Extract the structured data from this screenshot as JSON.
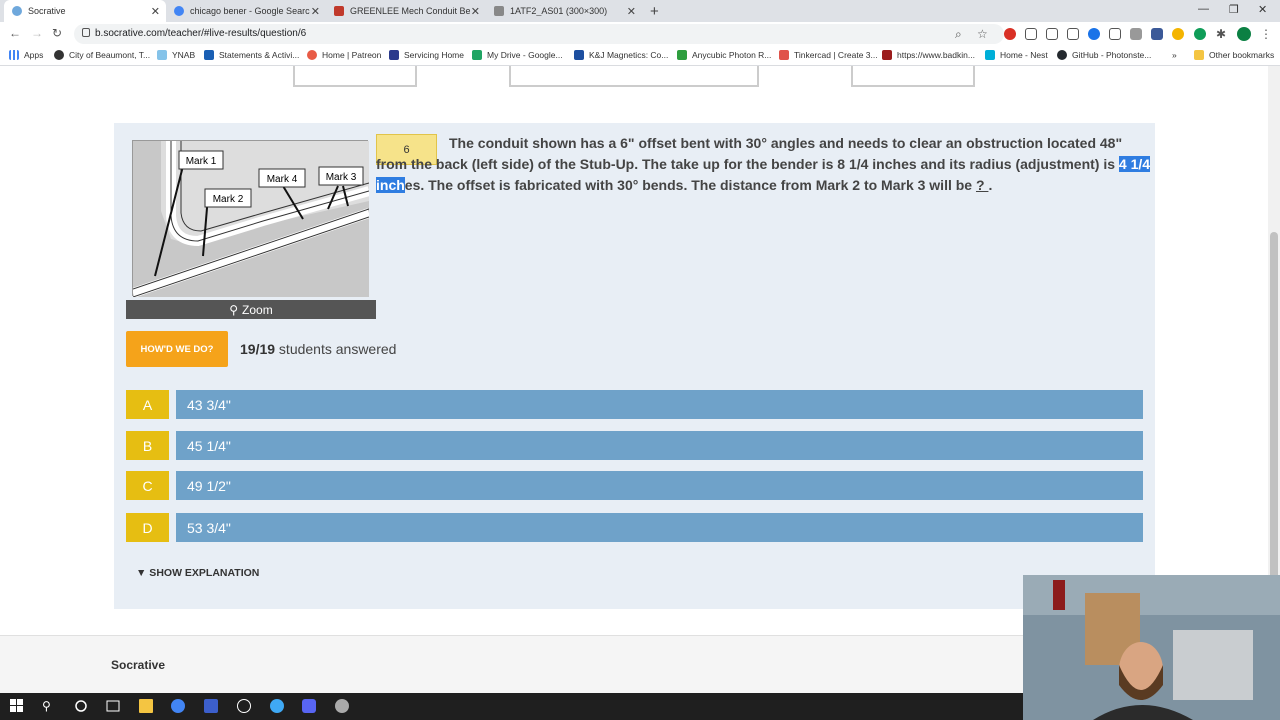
{
  "browser": {
    "tabs": [
      {
        "title": "Socrative",
        "active": true
      },
      {
        "title": "chicago bener - Google Search",
        "active": false
      },
      {
        "title": "GREENLEE Mech Conduit Bender",
        "active": false
      },
      {
        "title": "1ATF2_AS01 (300×300)",
        "active": false
      }
    ],
    "new_tab": "+",
    "close_glyph": "✕",
    "window_controls": {
      "minimize": "—",
      "maximize": "❐",
      "close": "✕"
    },
    "url": "b.socrative.com/teacher/#live-results/question/6",
    "bookmarks": [
      {
        "label": "Apps",
        "color": "#4285f4"
      },
      {
        "label": "City of Beaumont, T...",
        "color": "#333333"
      },
      {
        "label": "YNAB",
        "color": "#85c3e9"
      },
      {
        "label": "Statements & Activi...",
        "color": "#1a5fb4"
      },
      {
        "label": "Home | Patreon",
        "color": "#e85b46"
      },
      {
        "label": "Servicing Home",
        "color": "#2b3a8c"
      },
      {
        "label": "My Drive - Google...",
        "color": "#1fa463"
      },
      {
        "label": "K&J Magnetics: Co...",
        "color": "#1d4fa0"
      },
      {
        "label": "Anycubic Photon R...",
        "color": "#2e9e3e"
      },
      {
        "label": "Tinkercad | Create 3...",
        "color": "#e0534a"
      },
      {
        "label": "https://www.badkin...",
        "color": "#9b1c1c"
      },
      {
        "label": "Home - Nest",
        "color": "#00afd8"
      },
      {
        "label": "GitHub - Photonste...",
        "color": "#24292e"
      },
      {
        "label": "Other bookmarks",
        "color": "#f4c542"
      }
    ],
    "bookmarks_overflow": "»"
  },
  "question": {
    "number": "6",
    "text_before": "The conduit shown has a 6\" offset bent with 30° angles and needs to clear an obstruction located 48\" from the back (left side) of the Stub-Up. The take up for the bender is 8 1/4 inches and its radius (adjustment) is ",
    "text_highlight": "4 1/4 inch",
    "text_after": "es. The offset is fabricated with 30° bends. The distance from Mark 2 to Mark 3 will be ",
    "blank": " ? ",
    "text_end": ".",
    "diagram_labels": {
      "mark1": "Mark 1",
      "mark2": "Mark 2",
      "mark3": "Mark 3",
      "mark4": "Mark 4"
    },
    "zoom_label": "Zoom"
  },
  "results": {
    "howd_button": "HOW'D WE DO?",
    "answered_count": "19/19",
    "answered_suffix": " students answered"
  },
  "choices": [
    {
      "letter": "A",
      "text": "43 3/4\""
    },
    {
      "letter": "B",
      "text": "45 1/4\""
    },
    {
      "letter": "C",
      "text": "49 1/2\""
    },
    {
      "letter": "D",
      "text": "53 3/4\""
    }
  ],
  "show_explanation": "▼ SHOW EXPLANATION",
  "footer": {
    "brand": "Socrative"
  },
  "colors": {
    "highlight": "#2f7de1",
    "choice_letter": "#e6be12",
    "choice_bar": "#6fa2c9",
    "howd": "#f5a31a"
  }
}
